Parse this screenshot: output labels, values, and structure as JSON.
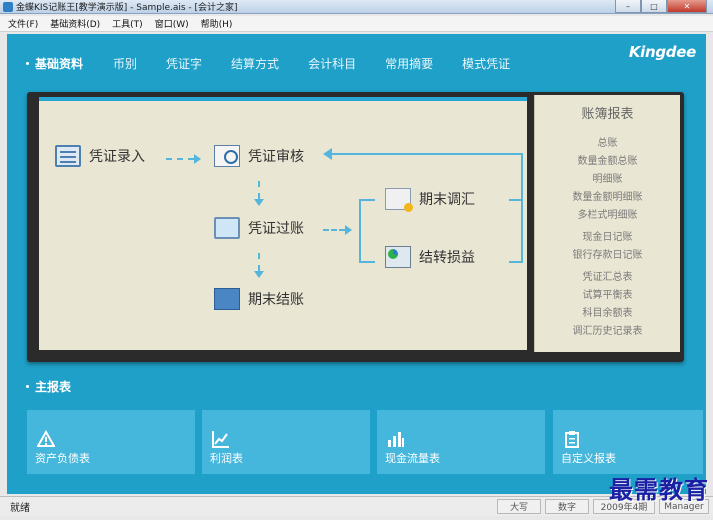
{
  "window": {
    "title": "金蝶KIS记账王[教学演示版] - Sample.ais - [会计之家]"
  },
  "menu": [
    "文件(F)",
    "基础资料(D)",
    "工具(T)",
    "窗口(W)",
    "帮助(H)"
  ],
  "nav": {
    "items": [
      "基础资料",
      "币别",
      "凭证字",
      "结算方式",
      "会计科目",
      "常用摘要",
      "模式凭证"
    ],
    "brand": "Kingdee"
  },
  "flow": {
    "voucher_entry": "凭证录入",
    "voucher_audit": "凭证审核",
    "voucher_post": "凭证过账",
    "period_close": "期末结账",
    "period_adjust": "期末调汇",
    "carry_pl": "结转损益"
  },
  "ledger": {
    "title": "账簿报表",
    "group1": [
      "总账",
      "数量金额总账",
      "明细账",
      "数量金额明细账",
      "多栏式明细账"
    ],
    "group2": [
      "现金日记账",
      "银行存款日记账"
    ],
    "group3": [
      "凭证汇总表",
      "试算平衡表",
      "科目余额表",
      "调汇历史记录表"
    ]
  },
  "main_reports": {
    "title": "主报表",
    "tiles": [
      {
        "label": "资产负债表",
        "icon": "warning-icon"
      },
      {
        "label": "利润表",
        "icon": "line-chart-icon"
      },
      {
        "label": "现金流量表",
        "icon": "bar-chart-icon"
      },
      {
        "label": "自定义报表",
        "icon": "clipboard-icon"
      }
    ]
  },
  "status": {
    "left": "就绪",
    "caps": "大写",
    "num": "数字",
    "period": "2009年4期",
    "user": "Manager"
  },
  "watermark": "最需教育",
  "colors": {
    "main_bg": "#1fa0c9",
    "tile_bg": "#45b6dc",
    "panel_bg": "#eae6d4"
  }
}
